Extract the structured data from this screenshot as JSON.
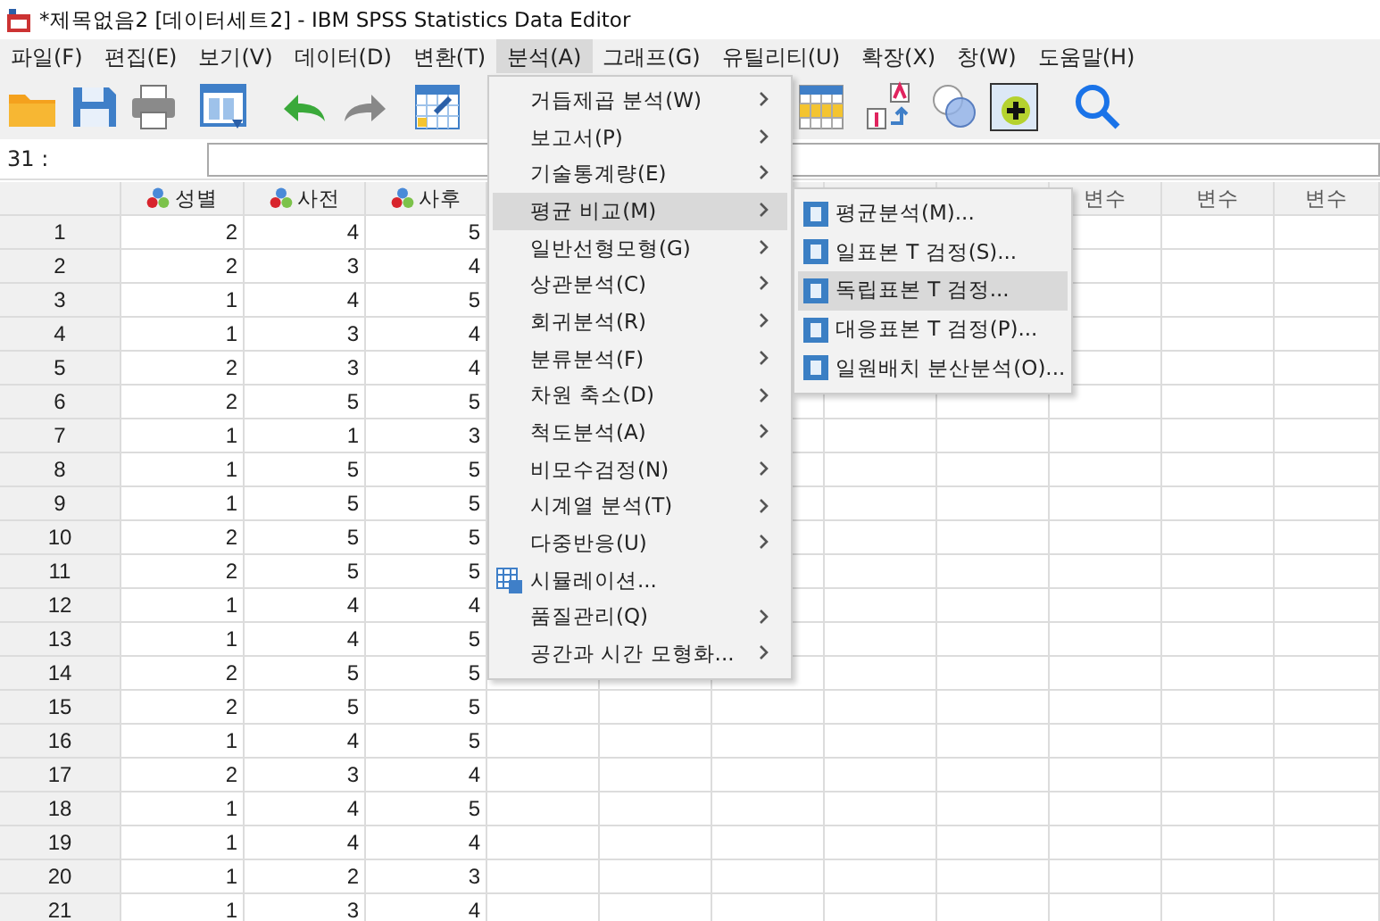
{
  "window": {
    "title": "*제목없음2 [데이터세트2] - IBM SPSS Statistics Data Editor"
  },
  "menubar": [
    {
      "label": "파일(F)",
      "selected": false
    },
    {
      "label": "편집(E)",
      "selected": false
    },
    {
      "label": "보기(V)",
      "selected": false
    },
    {
      "label": "데이터(D)",
      "selected": false
    },
    {
      "label": "변환(T)",
      "selected": false
    },
    {
      "label": "분석(A)",
      "selected": true
    },
    {
      "label": "그래프(G)",
      "selected": false
    },
    {
      "label": "유틸리티(U)",
      "selected": false
    },
    {
      "label": "확장(X)",
      "selected": false
    },
    {
      "label": "창(W)",
      "selected": false
    },
    {
      "label": "도움말(H)",
      "selected": false
    }
  ],
  "cell_editor": {
    "cell_ref": "31 :"
  },
  "table": {
    "columns": [
      {
        "label": "성별",
        "kind": "nominal"
      },
      {
        "label": "사전",
        "kind": "nominal"
      },
      {
        "label": "사후",
        "kind": "nominal"
      }
    ],
    "empty_columns": [
      "변수",
      "변수",
      "변수"
    ],
    "rows": [
      {
        "num": "1",
        "cells": [
          "2",
          "4",
          "5"
        ]
      },
      {
        "num": "2",
        "cells": [
          "2",
          "3",
          "4"
        ]
      },
      {
        "num": "3",
        "cells": [
          "1",
          "4",
          "5"
        ]
      },
      {
        "num": "4",
        "cells": [
          "1",
          "3",
          "4"
        ]
      },
      {
        "num": "5",
        "cells": [
          "2",
          "3",
          "4"
        ]
      },
      {
        "num": "6",
        "cells": [
          "2",
          "5",
          "5"
        ]
      },
      {
        "num": "7",
        "cells": [
          "1",
          "1",
          "3"
        ]
      },
      {
        "num": "8",
        "cells": [
          "1",
          "5",
          "5"
        ]
      },
      {
        "num": "9",
        "cells": [
          "1",
          "5",
          "5"
        ]
      },
      {
        "num": "10",
        "cells": [
          "2",
          "5",
          "5"
        ]
      },
      {
        "num": "11",
        "cells": [
          "2",
          "5",
          "5"
        ]
      },
      {
        "num": "12",
        "cells": [
          "1",
          "4",
          "4"
        ]
      },
      {
        "num": "13",
        "cells": [
          "1",
          "4",
          "5"
        ]
      },
      {
        "num": "14",
        "cells": [
          "2",
          "5",
          "5"
        ]
      },
      {
        "num": "15",
        "cells": [
          "2",
          "5",
          "5"
        ]
      },
      {
        "num": "16",
        "cells": [
          "1",
          "4",
          "5"
        ]
      },
      {
        "num": "17",
        "cells": [
          "2",
          "3",
          "4"
        ]
      },
      {
        "num": "18",
        "cells": [
          "1",
          "4",
          "5"
        ]
      },
      {
        "num": "19",
        "cells": [
          "1",
          "4",
          "4"
        ]
      },
      {
        "num": "20",
        "cells": [
          "1",
          "2",
          "3"
        ]
      },
      {
        "num": "21",
        "cells": [
          "1",
          "3",
          "4"
        ]
      }
    ]
  },
  "analyze_menu": {
    "items": [
      {
        "label": "거듭제곱 분석(W)",
        "kind": "submenu",
        "selected": false
      },
      {
        "label": "보고서(P)",
        "kind": "submenu",
        "selected": false
      },
      {
        "label": "기술통계량(E)",
        "kind": "submenu",
        "selected": false
      },
      {
        "label": "평균 비교(M)",
        "kind": "submenu",
        "selected": true
      },
      {
        "label": "일반선형모형(G)",
        "kind": "submenu",
        "selected": false
      },
      {
        "label": "상관분석(C)",
        "kind": "submenu",
        "selected": false
      },
      {
        "label": "회귀분석(R)",
        "kind": "submenu",
        "selected": false
      },
      {
        "label": "분류분석(F)",
        "kind": "submenu",
        "selected": false
      },
      {
        "label": "차원 축소(D)",
        "kind": "submenu",
        "selected": false
      },
      {
        "label": "척도분석(A)",
        "kind": "submenu",
        "selected": false
      },
      {
        "label": "비모수검정(N)",
        "kind": "submenu",
        "selected": false
      },
      {
        "label": "시계열 분석(T)",
        "kind": "submenu",
        "selected": false
      },
      {
        "label": "다중반응(U)",
        "kind": "submenu",
        "selected": false
      },
      {
        "label": "시뮬레이션...",
        "kind": "command",
        "selected": false
      },
      {
        "label": "품질관리(Q)",
        "kind": "submenu",
        "selected": false
      },
      {
        "label": "공간과 시간 모형화...",
        "kind": "submenu",
        "selected": false
      }
    ]
  },
  "submenu": {
    "items": [
      {
        "label": "평균분석(M)...",
        "selected": false
      },
      {
        "label": "일표본 T 검정(S)...",
        "selected": false
      },
      {
        "label": "독립표본 T 검정...",
        "selected": true
      },
      {
        "label": "대응표본 T 검정(P)...",
        "selected": false
      },
      {
        "label": "일원배치 분산분석(O)...",
        "selected": false
      }
    ]
  }
}
